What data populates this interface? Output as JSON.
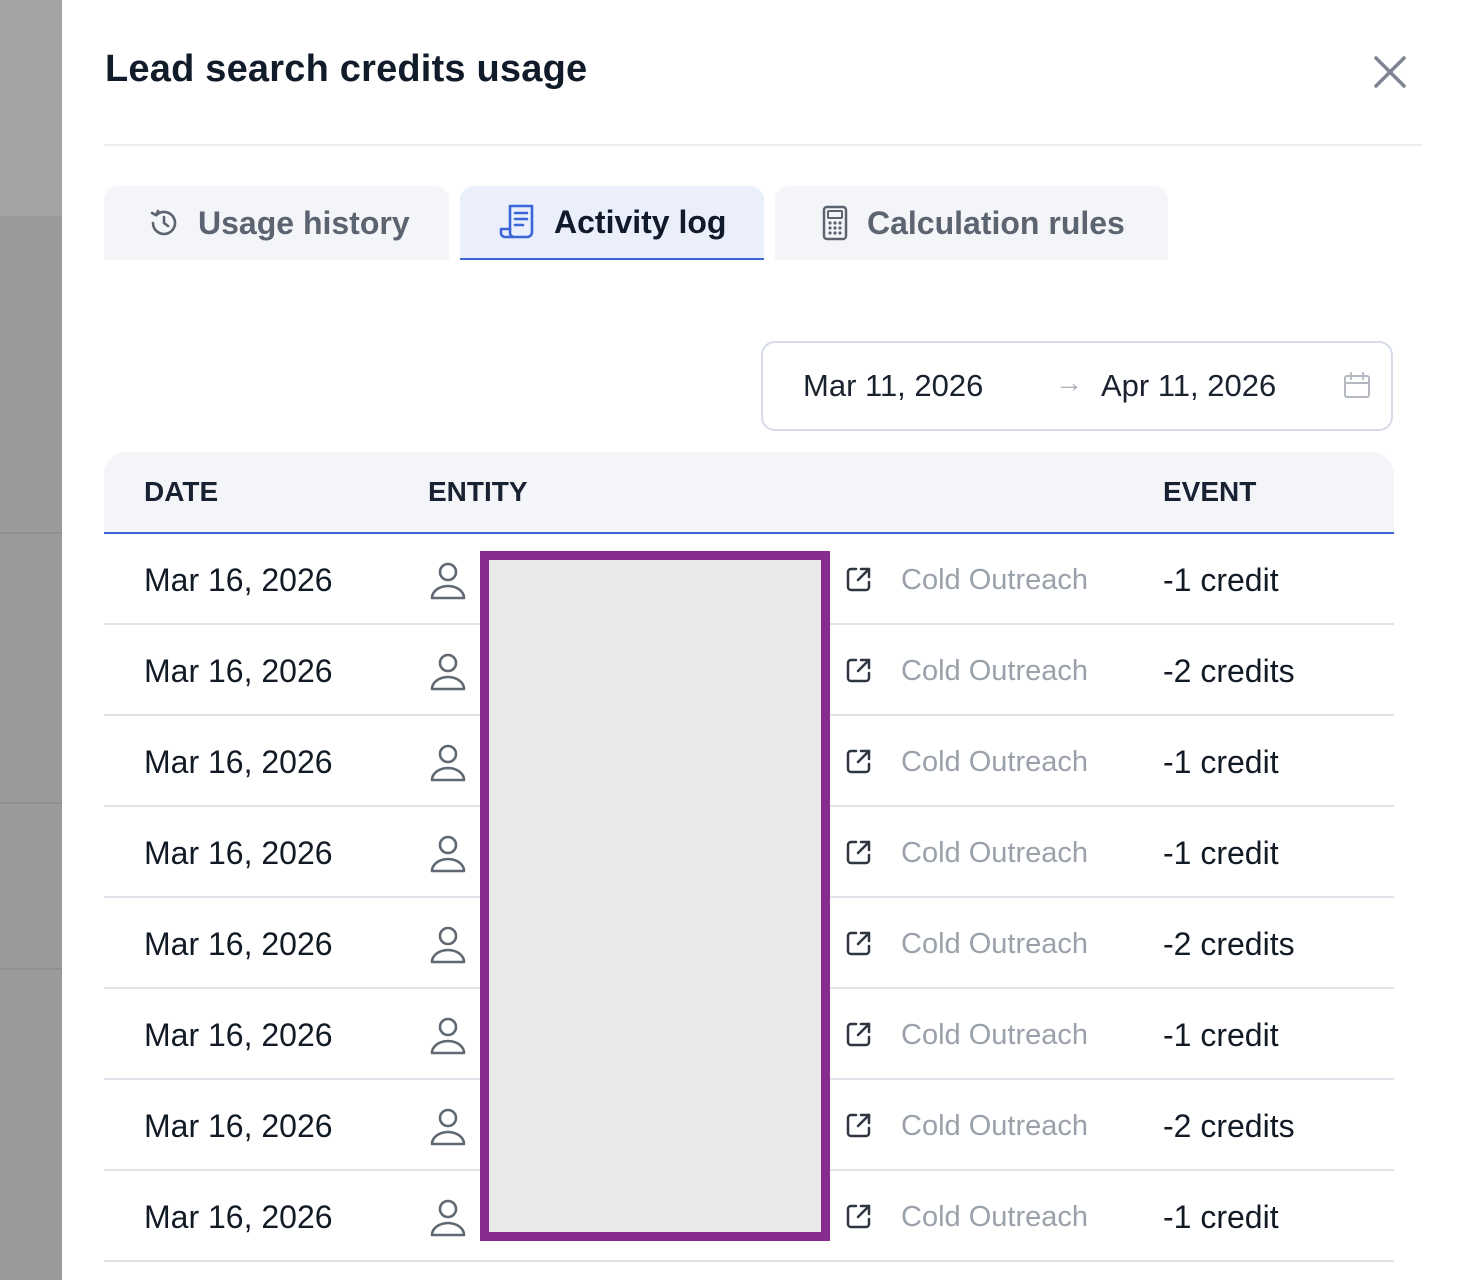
{
  "modal": {
    "title": "Lead search credits usage"
  },
  "tabs": [
    {
      "label": "Usage history",
      "icon": "history-icon",
      "active": false
    },
    {
      "label": "Activity log",
      "icon": "receipt-icon",
      "active": true
    },
    {
      "label": "Calculation rules",
      "icon": "calculator-icon",
      "active": false
    }
  ],
  "date_range": {
    "start": "Mar 11, 2026",
    "end": "Apr 11, 2026",
    "separator": "→",
    "icon": "calendar-icon"
  },
  "table": {
    "columns": [
      "DATE",
      "ENTITY",
      "EVENT"
    ],
    "rows": [
      {
        "date": "Mar 16, 2026",
        "source": "Cold Outreach",
        "event": "-1 credit"
      },
      {
        "date": "Mar 16, 2026",
        "source": "Cold Outreach",
        "event": "-2 credits"
      },
      {
        "date": "Mar 16, 2026",
        "source": "Cold Outreach",
        "event": "-1 credit"
      },
      {
        "date": "Mar 16, 2026",
        "source": "Cold Outreach",
        "event": "-1 credit"
      },
      {
        "date": "Mar 16, 2026",
        "source": "Cold Outreach",
        "event": "-2 credits"
      },
      {
        "date": "Mar 16, 2026",
        "source": "Cold Outreach",
        "event": "-1 credit"
      },
      {
        "date": "Mar 16, 2026",
        "source": "Cold Outreach",
        "event": "-2 credits"
      },
      {
        "date": "Mar 16, 2026",
        "source": "Cold Outreach",
        "event": "-1 credit"
      }
    ]
  },
  "colors": {
    "accent": "#3b66d9",
    "redaction_border": "#872b8c",
    "redaction_fill": "#e9e9ea"
  }
}
